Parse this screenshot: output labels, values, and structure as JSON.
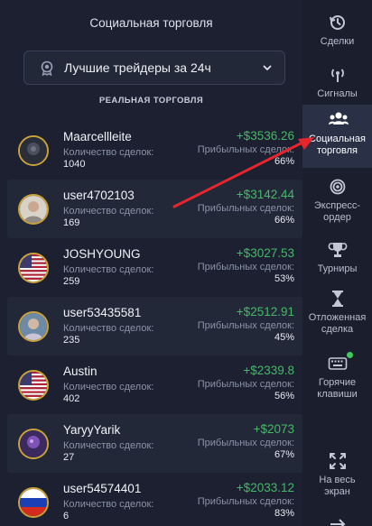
{
  "panel": {
    "title": "Социальная торговля",
    "filter_label": "Лучшие трейдеры за 24ч",
    "section": "РЕАЛЬНАЯ ТОРГОВЛЯ",
    "deals_label": "Количество сделок:",
    "profit_label": "Прибыльных сделок:"
  },
  "traders": [
    {
      "name": "Maarcellleite",
      "deals": "1040",
      "profit": "+$3536.26",
      "rate": "66%",
      "avatar": "dark"
    },
    {
      "name": "user4702103",
      "deals": "169",
      "profit": "+$3142.44",
      "rate": "66%",
      "avatar": "photo"
    },
    {
      "name": "JOSHYOUNG",
      "deals": "259",
      "profit": "+$3027.53",
      "rate": "53%",
      "avatar": "us"
    },
    {
      "name": "user53435581",
      "deals": "235",
      "profit": "+$2512.91",
      "rate": "45%",
      "avatar": "photo2"
    },
    {
      "name": "Austin",
      "deals": "402",
      "profit": "+$2339.8",
      "rate": "56%",
      "avatar": "us"
    },
    {
      "name": "YaryyYarik",
      "deals": "27",
      "profit": "+$2073",
      "rate": "67%",
      "avatar": "purple"
    },
    {
      "name": "user54574401",
      "deals": "6",
      "profit": "+$2033.12",
      "rate": "83%",
      "avatar": "ru"
    }
  ],
  "sidebar": {
    "deals": "Сделки",
    "signals": "Сигналы",
    "social_1": "Социальная",
    "social_2": "торговля",
    "express_1": "Экспресс-",
    "express_2": "ордер",
    "tournaments": "Турниры",
    "pending_1": "Отложенная",
    "pending_2": "сделка",
    "hotkeys_1": "Горячие",
    "hotkeys_2": "клавиши",
    "fullscreen_1": "На весь",
    "fullscreen_2": "экран"
  },
  "colors": {
    "profit": "#47b768",
    "accent_arrow": "#e5262b",
    "badge_dot": "#3ecb5b"
  },
  "icons": [
    "history-icon",
    "signal-icon",
    "people-icon",
    "target-icon",
    "trophy-icon",
    "hourglass-icon",
    "keyboard-icon",
    "fullscreen-icon",
    "arrow-right-icon",
    "medal-icon",
    "chevron-down-icon"
  ]
}
